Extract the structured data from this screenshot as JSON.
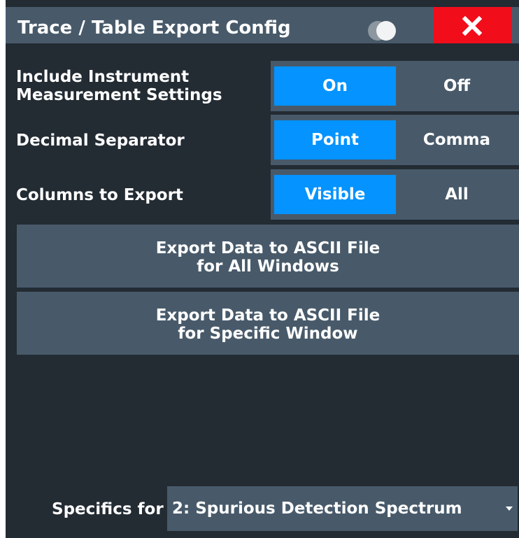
{
  "dialog": {
    "title": "Trace / Table Export Config",
    "close_label": "close"
  },
  "settings": {
    "include_settings": {
      "label_line1": "Include Instrument",
      "label_line2": "Measurement Settings",
      "options": [
        "On",
        "Off"
      ],
      "selected": "On"
    },
    "decimal_separator": {
      "label": "Decimal Separator",
      "options": [
        "Point",
        "Comma"
      ],
      "selected": "Point"
    },
    "columns_to_export": {
      "label": "Columns to Export",
      "options": [
        "Visible",
        "All"
      ],
      "selected": "Visible"
    }
  },
  "actions": {
    "export_all": {
      "line1": "Export Data to ASCII File",
      "line2": "for All Windows"
    },
    "export_specific": {
      "line1": "Export Data to ASCII File",
      "line2": "for Specific Window"
    }
  },
  "specifics": {
    "label": "Specifics for",
    "value": "2: Spurious Detection Spectrum"
  },
  "colors": {
    "background": "#232b33",
    "panel": "#485a6a",
    "accent": "#0493ff",
    "close": "#f20d1b"
  }
}
